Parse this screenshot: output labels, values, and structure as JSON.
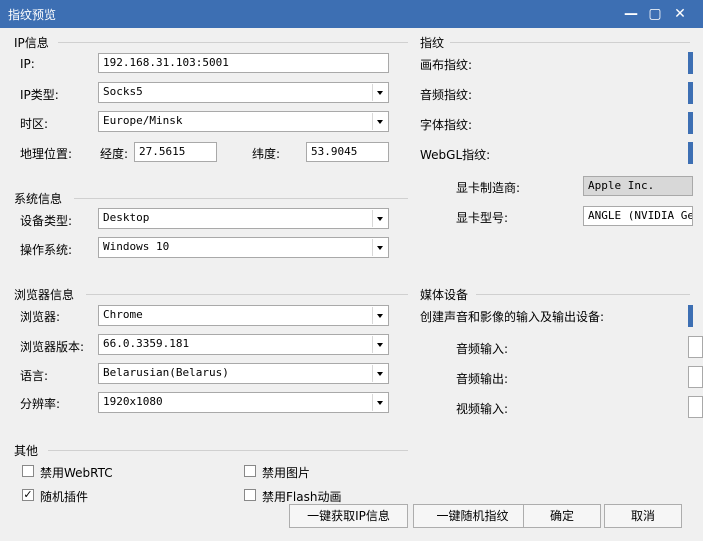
{
  "window": {
    "title": "指纹预览",
    "minimize_icon": "minimize-icon",
    "maximize_icon": "maximize-icon",
    "close_icon": "close-icon"
  },
  "ip": {
    "section_title": "IP信息",
    "ip_label": "IP:",
    "ip_value": "192.168.31.103:5001",
    "type_label": "IP类型:",
    "type_value": "Socks5",
    "timezone_label": "时区:",
    "timezone_value": "Europe/Minsk",
    "geo_label": "地理位置:",
    "lon_label": "经度:",
    "lon_value": "27.5615",
    "lat_label": "纬度:",
    "lat_value": "53.9045"
  },
  "system": {
    "section_title": "系统信息",
    "device_label": "设备类型:",
    "device_value": "Desktop",
    "os_label": "操作系统:",
    "os_value": "Windows 10"
  },
  "browser": {
    "section_title": "浏览器信息",
    "browser_label": "浏览器:",
    "browser_value": "Chrome",
    "version_label": "浏览器版本:",
    "version_value": "66.0.3359.181",
    "language_label": "语言:",
    "language_value": "Belarusian(Belarus)",
    "resolution_label": "分辨率:",
    "resolution_value": "1920x1080"
  },
  "other": {
    "section_title": "其他",
    "webrtc_label": "禁用WebRTC",
    "webrtc_checked": false,
    "images_label": "禁用图片",
    "images_checked": false,
    "plugins_label": "随机插件",
    "plugins_checked": true,
    "plugins_mark": "✓",
    "flash_label": "禁用Flash动画",
    "flash_checked": false
  },
  "fingerprint": {
    "section_title": "指纹",
    "canvas_label": "画布指纹:",
    "audio_label": "音频指纹:",
    "font_label": "字体指纹:",
    "webgl_label": "WebGL指纹:",
    "gpu_vendor_label": "显卡制造商:",
    "gpu_vendor_value": "Apple Inc.",
    "gpu_model_label": "显卡型号:",
    "gpu_model_value": "ANGLE (NVIDIA GeFo"
  },
  "media": {
    "section_title": "媒体设备",
    "desc": "创建声音和影像的输入及输出设备:",
    "audio_in_label": "音频输入:",
    "audio_out_label": "音频输出:",
    "video_in_label": "视频输入:"
  },
  "buttons": {
    "get_ip": "一键获取IP信息",
    "random_fp": "一键随机指纹",
    "ok": "确定",
    "cancel": "取消"
  },
  "colors": {
    "titlebar": "#3d6fb3",
    "background": "#f0f0f0"
  }
}
